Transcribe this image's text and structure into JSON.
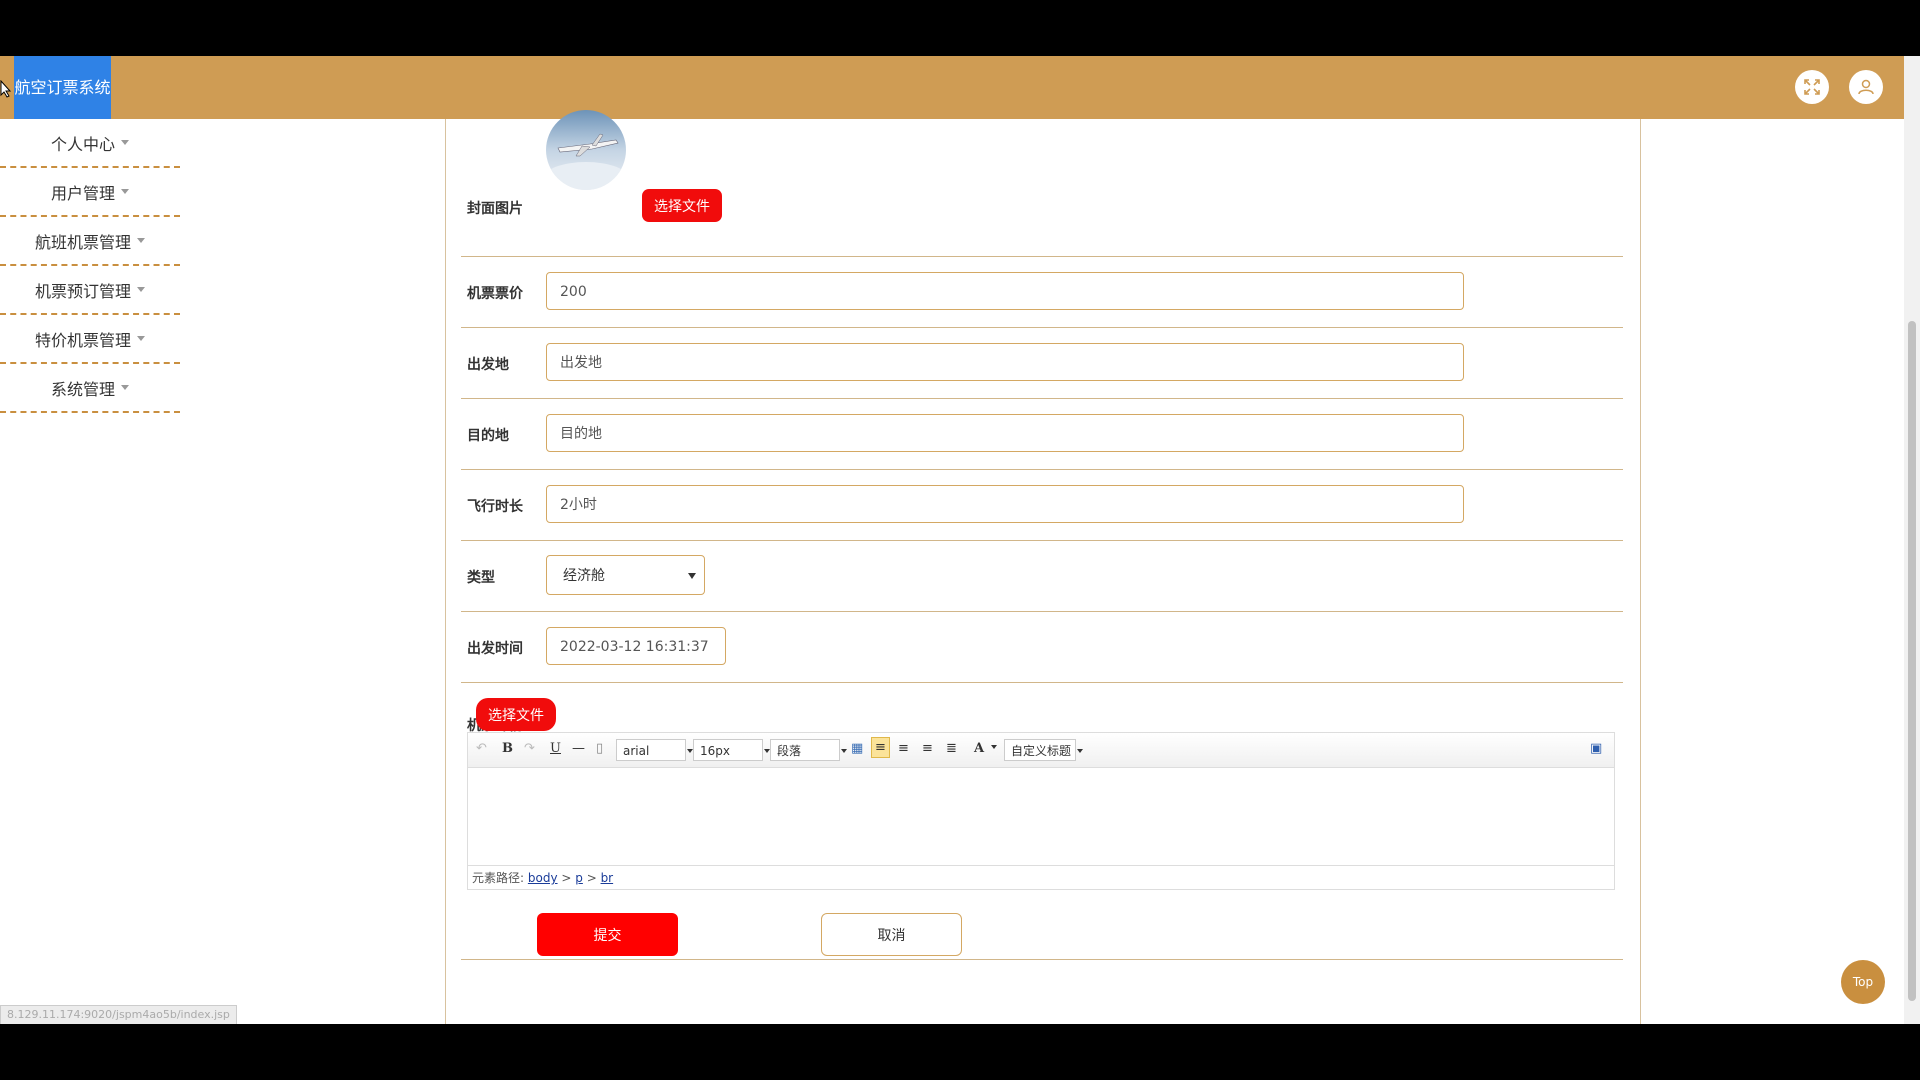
{
  "header": {
    "app_title": "航空订票系统",
    "icons": [
      "fullscreen-icon",
      "user-icon"
    ],
    "accent_color": "#cf9c54",
    "logo_color": "#2f82e6"
  },
  "sidebar": {
    "items": [
      {
        "label": "个人中心"
      },
      {
        "label": "用户管理"
      },
      {
        "label": "航班机票管理"
      },
      {
        "label": "机票预订管理"
      },
      {
        "label": "特价机票管理"
      },
      {
        "label": "系统管理"
      }
    ]
  },
  "form": {
    "cover": {
      "label": "封面图片",
      "button": "选择文件"
    },
    "price": {
      "label": "机票票价",
      "value": "200"
    },
    "departure": {
      "label": "出发地",
      "placeholder": "出发地"
    },
    "destination": {
      "label": "目的地",
      "placeholder": "目的地"
    },
    "duration": {
      "label": "飞行时长",
      "value": "2小时"
    },
    "type": {
      "label": "类型",
      "selected": "经济舱"
    },
    "depart_time": {
      "label": "出发时间",
      "value": "2022-03-12 16:31:37"
    },
    "detail": {
      "label": "机票详情",
      "button": "选择文件"
    },
    "submit": "提交",
    "cancel": "取消"
  },
  "editor": {
    "font": "arial",
    "size": "16px",
    "paragraph": "段落",
    "custom_title": "自定义标题",
    "path_label": "元素路径:",
    "path": [
      "body",
      "p",
      "br"
    ]
  },
  "back_to_top": "Top",
  "status_url": "8.129.11.174:9020/jspm4ao5b/index.jsp"
}
